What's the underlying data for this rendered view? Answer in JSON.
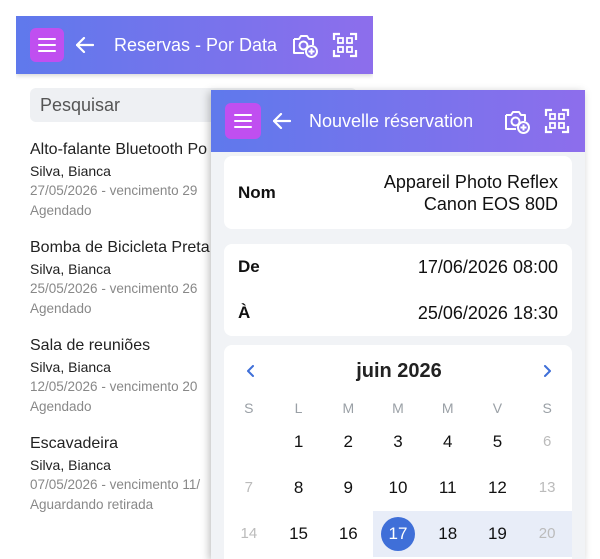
{
  "back_window": {
    "title": "Reservas - Por Data",
    "search_placeholder": "Pesquisar",
    "items": [
      {
        "title": "Alto-falante Bluetooth Po",
        "user": "Silva, Bianca",
        "date": "27/05/2026 - vencimento 29",
        "status": "Agendado"
      },
      {
        "title": "Bomba de Bicicleta Preta",
        "user": "Silva, Bianca",
        "date": "25/05/2026 - vencimento 26",
        "status": "Agendado"
      },
      {
        "title": "Sala de reuniões",
        "user": "Silva, Bianca",
        "date": "12/05/2026 - vencimento 20",
        "status": "Agendado"
      },
      {
        "title": "Escavadeira",
        "user": "Silva, Bianca",
        "date": "07/05/2026 - vencimento 11/",
        "status": "Aguardando retirada"
      }
    ]
  },
  "front_window": {
    "title": "Nouvelle réservation",
    "nom_label": "Nom",
    "nom_value_line1": "Appareil Photo Reflex",
    "nom_value_line2": "Canon EOS 80D",
    "de_label": "De",
    "de_value": "17/06/2026 08:00",
    "a_label": "À",
    "a_value": "25/06/2026 18:30",
    "calendar": {
      "month_title": "juin 2026",
      "weekdays": [
        "S",
        "L",
        "M",
        "M",
        "M",
        "V",
        "S"
      ],
      "rows": [
        [
          "",
          "1",
          "2",
          "3",
          "4",
          "5",
          "6"
        ],
        [
          "7",
          "8",
          "9",
          "10",
          "11",
          "12",
          "13"
        ],
        [
          "14",
          "15",
          "16",
          "17",
          "18",
          "19",
          "20"
        ]
      ]
    }
  },
  "icons": {
    "menu": "menu-icon",
    "back": "arrow-left-icon",
    "camera": "camera-add-icon",
    "scan": "qr-scan-icon",
    "prev": "chevron-left-icon",
    "next": "chevron-right-icon"
  },
  "colors": {
    "appbar_start": "#5f79ec",
    "appbar_end": "#8d6eec",
    "menu_button": "#c04ff0",
    "selected_day": "#3f6fd8",
    "range": "#e8edf8"
  }
}
